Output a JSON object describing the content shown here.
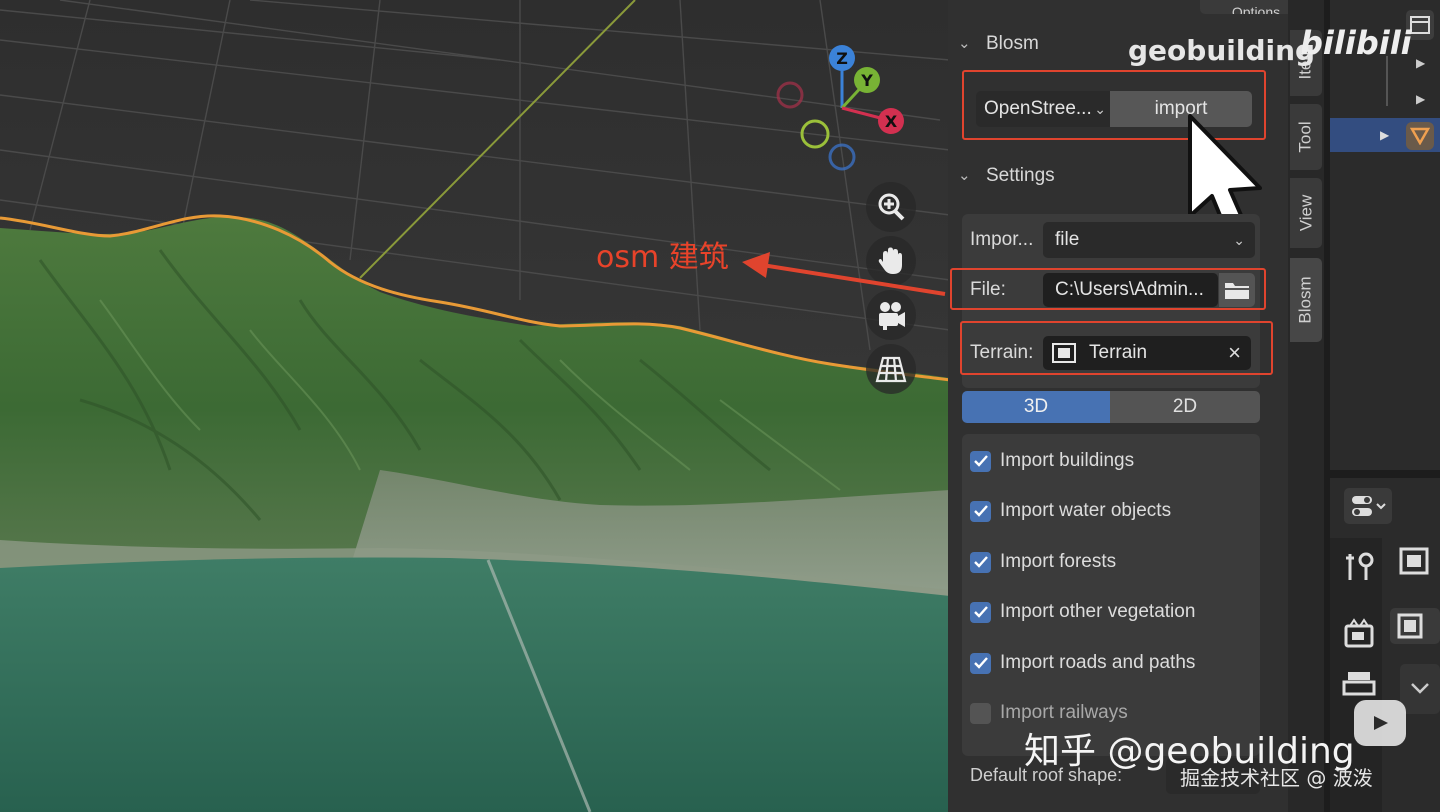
{
  "viewport": {
    "navigation": {
      "zoom_icon": "zoom-in-icon",
      "pan_icon": "hand-icon",
      "camera_icon": "camera-icon",
      "grid_icon": "grid-perspective-icon"
    },
    "gizmo": {
      "z": "Z",
      "y": "Y",
      "x": "X"
    },
    "annotation": "osm 建筑"
  },
  "header": {
    "options_label": "Options"
  },
  "blosm_panel": {
    "title": "Blosm",
    "source_select": "OpenStree...",
    "import_button": "import"
  },
  "settings_panel": {
    "title": "Settings",
    "import_label": "Impor...",
    "import_value": "file",
    "file_label": "File:",
    "file_value": "C:\\Users\\Admin...",
    "terrain_label": "Terrain:",
    "terrain_value": "Terrain",
    "mode_tabs": [
      {
        "label": "3D",
        "active": true
      },
      {
        "label": "2D",
        "active": false
      }
    ],
    "checkboxes": [
      {
        "label": "Import buildings",
        "checked": true
      },
      {
        "label": "Import water objects",
        "checked": true
      },
      {
        "label": "Import forests",
        "checked": true
      },
      {
        "label": "Import other vegetation",
        "checked": true
      },
      {
        "label": "Import roads and paths",
        "checked": true
      },
      {
        "label": "Import railways",
        "checked": false
      }
    ],
    "roof_label": "Default roof shape:"
  },
  "sidebar_tabs": [
    "Item",
    "Tool",
    "View",
    "Blosm"
  ],
  "colors": {
    "accent_blue": "#4772b3",
    "highlight_red": "#e0442e",
    "panel_bg": "#303030",
    "field_bg": "#1f1f1f"
  },
  "watermarks": {
    "top_right": "geobuilding",
    "bilibili": "bilibili",
    "zhihu": "知乎 @geobuilding",
    "juejin": "掘金技术社区 @ 波泼"
  }
}
